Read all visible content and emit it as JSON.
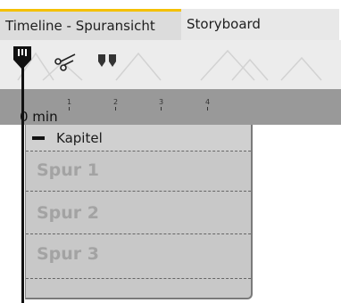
{
  "tabs": [
    {
      "label": "Timeline - Spuransicht",
      "active": true
    },
    {
      "label": "Storyboard",
      "active": false
    }
  ],
  "colors": {
    "active_tab_accent": "#f4c000",
    "ruler": "#999999",
    "chapter": "#c8c8c8"
  },
  "toolbar": {
    "icons": [
      "playhead-marker-icon",
      "scissors-icon",
      "split-marker-icon",
      "mountain-placeholder-icon"
    ]
  },
  "ruler": {
    "time_label": "0 min",
    "ticks": [
      "1",
      "2",
      "3",
      "4"
    ]
  },
  "chapter": {
    "title": "Kapitel",
    "tracks": [
      "Spur 1",
      "Spur 2",
      "Spur 3"
    ]
  }
}
